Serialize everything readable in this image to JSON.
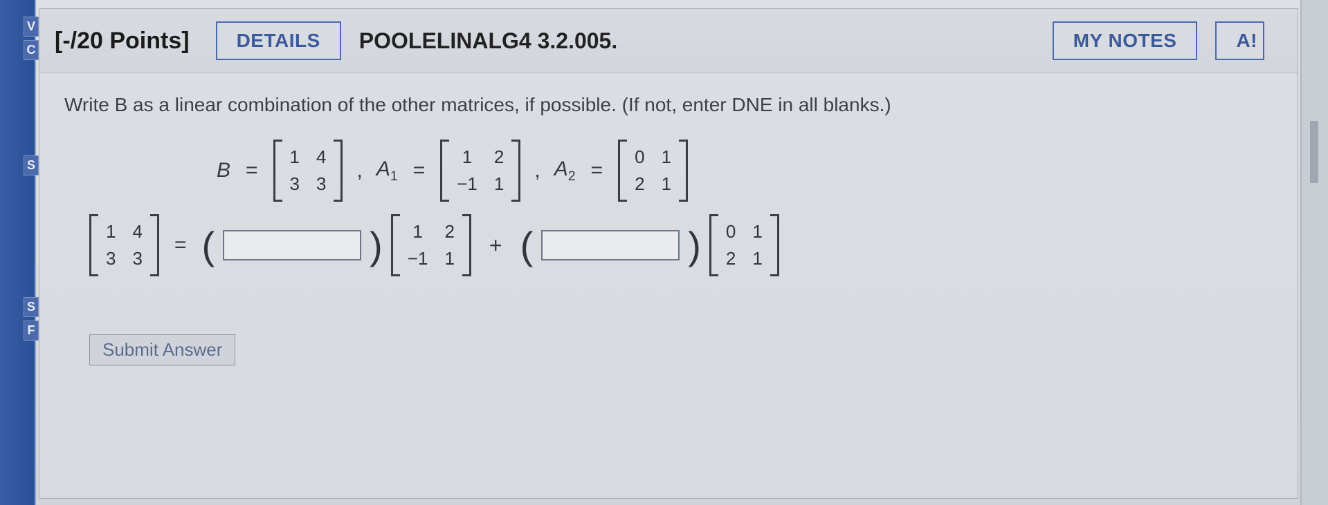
{
  "sidebar": {
    "tabs": [
      "V",
      "C",
      "S",
      "S",
      "F"
    ]
  },
  "header": {
    "points": "[-/20 Points]",
    "details_label": "DETAILS",
    "assignment_id": "POOLELINALG4 3.2.005.",
    "mynotes_label": "MY NOTES",
    "ask_label": "A!"
  },
  "question": {
    "prompt": "Write B as a linear combination of the other matrices, if possible. (If not, enter DNE in all blanks.)",
    "labels": {
      "B": "B",
      "A1": "A",
      "A1_sub": "1",
      "A2": "A",
      "A2_sub": "2",
      "equals": "=",
      "comma": ",",
      "plus": "+"
    },
    "matrices": {
      "B": [
        [
          "1",
          "4"
        ],
        [
          "3",
          "3"
        ]
      ],
      "A1": [
        [
          "1",
          "2"
        ],
        [
          "−1",
          "1"
        ]
      ],
      "A2": [
        [
          "0",
          "1"
        ],
        [
          "2",
          "1"
        ]
      ]
    },
    "submit_label": "Submit Answer"
  }
}
